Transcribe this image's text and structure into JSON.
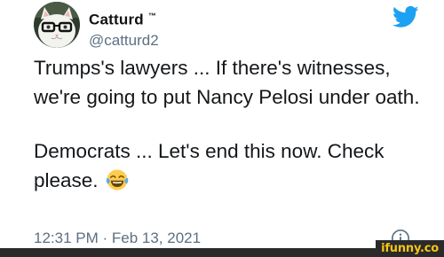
{
  "tweet": {
    "display_name": "Catturd",
    "trademark": "™",
    "handle": "@catturd2",
    "paragraph_1": "Trumps's lawyers ... If there's witnesses, we're going to put Nancy Pelosi under oath.",
    "paragraph_2": "Democrats ... Let's end this now. Check please.",
    "emoji": "face-with-tears-of-joy",
    "timestamp": "12:31 PM · Feb 13, 2021"
  },
  "icons": {
    "brand": "twitter-bird-icon",
    "info": "info-icon"
  },
  "colors": {
    "twitter_blue": "#1da1f2",
    "secondary_text": "#5b7083",
    "watermark_bg": "#2a2a2a",
    "watermark_text": "#f5c518"
  },
  "watermark": {
    "text": "ifunny.co"
  }
}
